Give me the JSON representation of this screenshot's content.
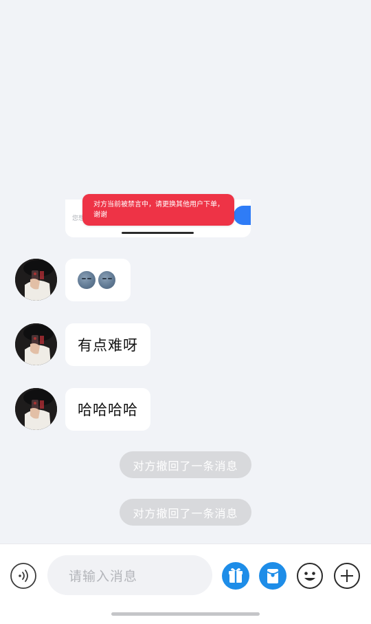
{
  "forwarded_screenshot": {
    "toast_text": "对方当前被禁言中，请更换其他用户下单，谢谢",
    "faint_label": "您想"
  },
  "messages": [
    {
      "sender": "other",
      "type": "emoji",
      "content": "moon-face-emoji x2"
    },
    {
      "sender": "other",
      "type": "text",
      "content": "有点难呀"
    },
    {
      "sender": "other",
      "type": "text",
      "content": "哈哈哈哈"
    }
  ],
  "system_notices": [
    "对方撤回了一条消息",
    "对方撤回了一条消息"
  ],
  "input_bar": {
    "placeholder": "请输入消息",
    "icons": [
      "voice-icon",
      "gift-icon",
      "red-packet-icon",
      "emoji-icon",
      "plus-icon"
    ],
    "accent_color": "#1e8de8"
  },
  "colors": {
    "background": "#f1f3f7",
    "toast_red": "#ee3346",
    "recall_pill": "#d8d9dc"
  }
}
